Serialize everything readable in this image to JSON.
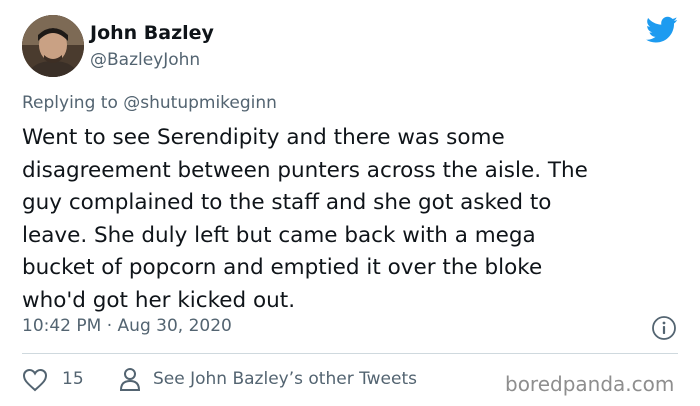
{
  "author": {
    "name": "John Bazley",
    "handle": "@BazleyJohn"
  },
  "reply": {
    "prefix": "Replying to",
    "mention": "@shutupmikeginn"
  },
  "tweet": {
    "lines": [
      "Went to see Serendipity and there was some",
      "disagreement between punters across the aisle. The",
      "guy complained to the staff and she got asked to",
      "leave. She duly left but came back with a mega",
      "bucket of popcorn and emptied it over the bloke",
      "who'd got her kicked out."
    ],
    "time": "10:42 PM",
    "separator": "·",
    "date": "Aug 30, 2020"
  },
  "actions": {
    "like_count": "15",
    "see_other_label": "See John Bazley’s other Tweets"
  },
  "watermark": "boredpanda.com",
  "colors": {
    "twitter_blue": "#1d9bf0",
    "text_primary": "#0f1419",
    "text_secondary": "#536471",
    "divider": "#cfd9de"
  },
  "icons": [
    "twitter-bird-icon",
    "info-icon",
    "heart-icon",
    "person-icon"
  ]
}
